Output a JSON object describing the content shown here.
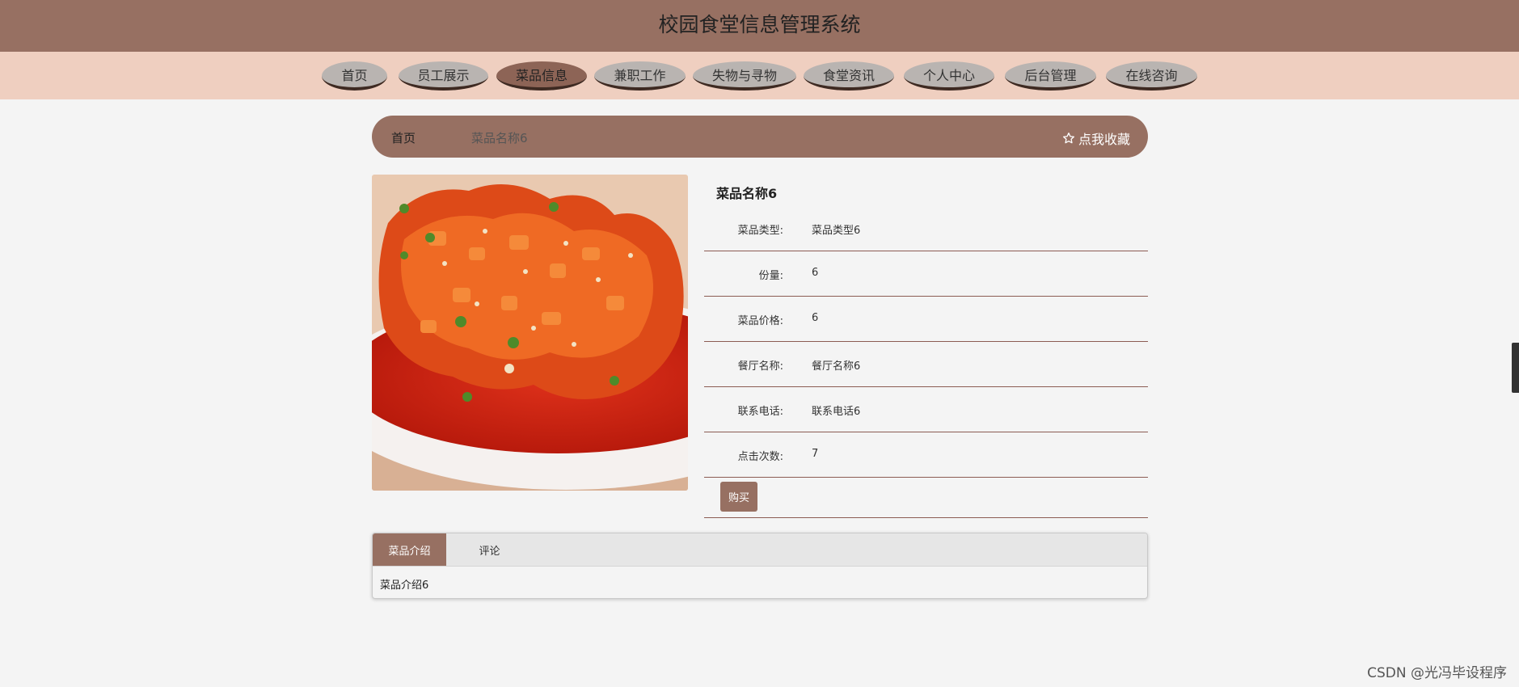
{
  "header": {
    "title": "校园食堂信息管理系统"
  },
  "nav": {
    "items": [
      "首页",
      "员工展示",
      "菜品信息",
      "兼职工作",
      "失物与寻物",
      "食堂资讯",
      "个人中心",
      "后台管理",
      "在线咨询"
    ],
    "active": "菜品信息"
  },
  "breadcrumb": {
    "home": "首页",
    "current": "菜品名称6",
    "favorite": "点我收藏",
    "favorite_icon": "star-outline-icon"
  },
  "dish": {
    "name": "菜品名称6",
    "fields": [
      {
        "label": "菜品类型:",
        "value": "菜品类型6"
      },
      {
        "label": "份量:",
        "value": "6"
      },
      {
        "label": "菜品价格:",
        "value": "6"
      },
      {
        "label": "餐厅名称:",
        "value": "餐厅名称6"
      },
      {
        "label": "联系电话:",
        "value": "联系电话6"
      },
      {
        "label": "点击次数:",
        "value": "7"
      }
    ],
    "buy_label": "购买"
  },
  "tabs": {
    "items": [
      "菜品介绍",
      "评论"
    ],
    "active": "菜品介绍",
    "content": "菜品介绍6"
  },
  "watermark": "CSDN @光冯毕设程序",
  "colors": {
    "brand": "#977062",
    "nav_background": "#efcfc0",
    "nav_pill": "#b9b4b1",
    "nav_pill_active": "#8d6456",
    "divider": "#8b5c53"
  }
}
